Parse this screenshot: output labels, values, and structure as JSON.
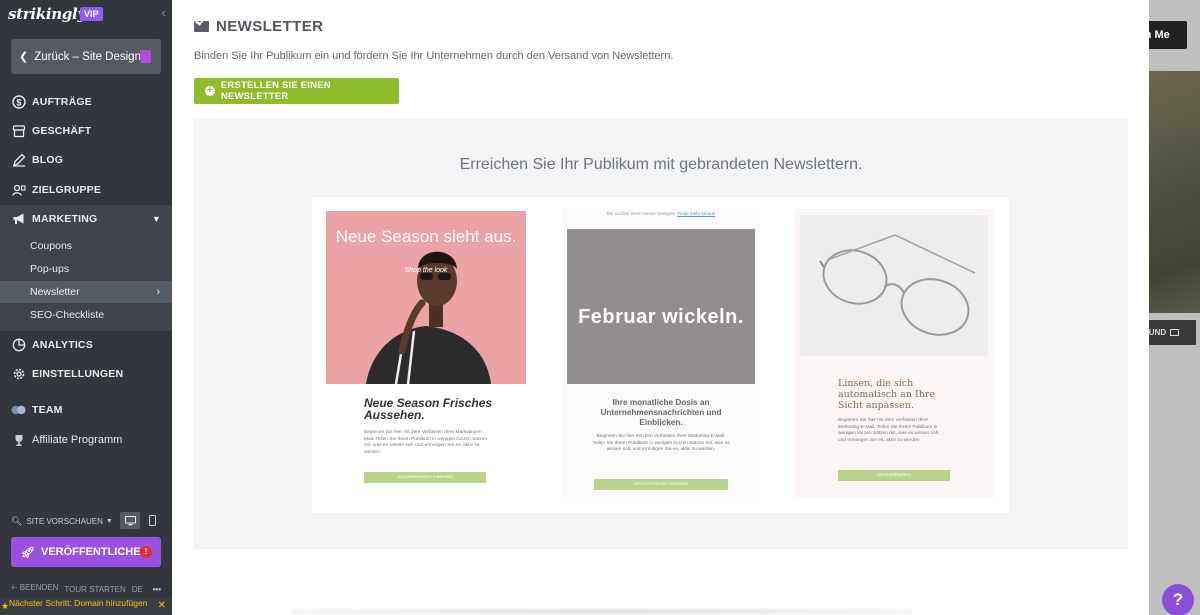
{
  "sidebar": {
    "logo": "strikingly",
    "vip_badge": "VIP",
    "back_button": "Zurück – Site Design",
    "nav": {
      "orders": "AUFTRÄGE",
      "store": "GESCHÄFT",
      "blog": "BLOG",
      "audience": "ZIELGRUPPE",
      "marketing": "MARKETING",
      "analytics": "ANALYTICS",
      "settings": "EINSTELLUNGEN",
      "team": "TEAM",
      "affiliate": "Affiliate Programm"
    },
    "marketing_sub": {
      "coupons": "Coupons",
      "popups": "Pop-ups",
      "newsletter": "Newsletter",
      "seo": "SEO-Checkliste"
    },
    "site_preview": "SITE VORSCHAUEN",
    "publish_button": "VERÖFFENTLICHEN",
    "publish_alert": "!",
    "bottom": {
      "exit": "BEENDEN",
      "tour": "TOUR STARTEN",
      "language": "DE",
      "more": "•••"
    },
    "next_step": "Nächster Schritt: Domain hinzufügen"
  },
  "panel": {
    "title": "NEWSLETTER",
    "description": "Binden Sie Ihr Publikum ein und fördern Sie Ihr Unternehmen durch den Versand von Newslettern.",
    "create_button": "ERSTELLEN SIE EINEN NEWSLETTER",
    "showcase_title": "Erreichen Sie Ihr Publikum mit gebrandeten Newslettern.",
    "templates": [
      {
        "hero_text": "Neue Season sieht aus.",
        "hero_subtext": "Shop the look",
        "heading": "Neue Season Frisches Aussehen.",
        "body": "Beginnen Sie hier mit dem Verfassen Ihrer Marketing-E-Mail. Teilen Sie Ihrem Publikum in wenigen kurzen Sätzen mit, was es wissen soll, und ermutigen Sie es, aktiv zu werden.",
        "cta": "SONDERANGEBOT EINSEHEN"
      },
      {
        "top_line": "Wir suchen einen Senior Designer.",
        "top_link": "Finde mehr heraus",
        "hero_text": "Februar wickeln.",
        "heading": "Ihre monatliche Dosis an Unternehmensnachrichten und Einblicken.",
        "body": "Beginnen Sie hier mit dem Verfassen Ihrer Marketing-E-Mail. Teilen Sie Ihrem Publikum in wenigen kurzen Sätzen mit, was es wissen soll, und ermutigen Sie es, aktiv zu werden.",
        "cta": "LETZTES PROJEKT ANSEHEN"
      },
      {
        "heading": "Linsen, die sich automatisch an Ihre Sicht anpassen.",
        "body": "Beginnen Sie hier mit dem Verfassen Ihrer Marketing-E-Mail. Teilen Sie Ihrem Publikum in wenigen kurzen Sätzen mit, was es wissen soll, und ermutigen Sie es, aktiv zu werden.",
        "cta": "MEHR ERFAHREN"
      }
    ]
  },
  "site_behind": {
    "button_partial": "th Me",
    "background_button_partial": "RUND",
    "help_icon": "?"
  },
  "colors": {
    "sidebar_bg": "#33373d",
    "accent_green": "#8fbc2b",
    "publish_purple": "#9b51e0",
    "alert_red": "#e02f3c",
    "next_step_yellow": "#f5c400"
  }
}
